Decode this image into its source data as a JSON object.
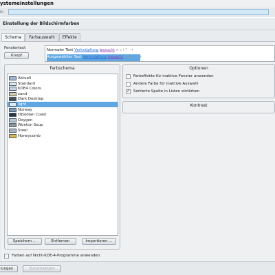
{
  "window": {
    "title": "ystemeinstellungen"
  },
  "search": {
    "label": "n:",
    "value": ""
  },
  "section_title": "Einstellung der Bildschirmfarben",
  "tabs": [
    {
      "label": "Schema",
      "active": true
    },
    {
      "label": "Farbauswahl",
      "active": false
    },
    {
      "label": "Effekte",
      "active": false
    }
  ],
  "window_colors": {
    "label": "Fenstertext",
    "button": "Knopf",
    "normal_row": {
      "normal": "Normaler Text",
      "link": "Verknüpfung",
      "visited": "besucht",
      "rest": "n  c  i  ?  ·  +"
    },
    "selected_row": {
      "normal": "Ausgewählter Text",
      "link": "Verknüpfung",
      "visited": "besucht",
      "rest": "n  c  i  ?  ·  +"
    }
  },
  "scheme_group": {
    "title": "Farbschema",
    "items": [
      {
        "name": "Aktuell",
        "swatch": "#9fb6cf",
        "selected": false
      },
      {
        "name": "Standard",
        "swatch": "#dfe6ee",
        "selected": false
      },
      {
        "name": "KDE4 Colors",
        "swatch": "#c8d3de",
        "selected": false
      },
      {
        "name": "zand",
        "swatch": "#d8c9a4",
        "selected": false
      },
      {
        "name": "Dark Desktop",
        "swatch": "#4a4f55",
        "selected": false
      },
      {
        "name": "light",
        "swatch": "#e4ebf2",
        "selected": true
      },
      {
        "name": "Norway",
        "swatch": "#7f9ab5",
        "selected": false
      },
      {
        "name": "Obsidian Coast",
        "swatch": "#2e3640",
        "selected": false
      },
      {
        "name": "Oxygen",
        "swatch": "#b9c7d4",
        "selected": false
      },
      {
        "name": "Wonton Soup",
        "swatch": "#8e969e",
        "selected": false
      },
      {
        "name": "Steel",
        "swatch": "#a9b3bd",
        "selected": false
      },
      {
        "name": "Honeycomb",
        "swatch": "#e0b64a",
        "selected": false
      }
    ],
    "buttons": {
      "save": "Speichern ...",
      "remove": "Entfernen",
      "import": "Importieren ..."
    }
  },
  "options_group": {
    "title": "Optionen",
    "options": [
      {
        "label": "Farbeffekte für inaktive Fenster anwenden",
        "checked": false
      },
      {
        "label": "Andere Farbe für inaktive Auswahl",
        "checked": false
      },
      {
        "label": "Sortierte Spalte in Listen einfärben",
        "checked": true
      }
    ]
  },
  "contrast_group": {
    "title": "Kontrast"
  },
  "apply_non_kde": {
    "label": "Farben auf Nicht-KDE-4-Programme anwenden",
    "checked": false
  },
  "footer": {
    "changes": "lungen",
    "reset": "Zurücksetzen"
  },
  "colors": {
    "selection": "#5fa7e3",
    "link": "#2b6dd2",
    "visited": "#8a3fb0"
  }
}
